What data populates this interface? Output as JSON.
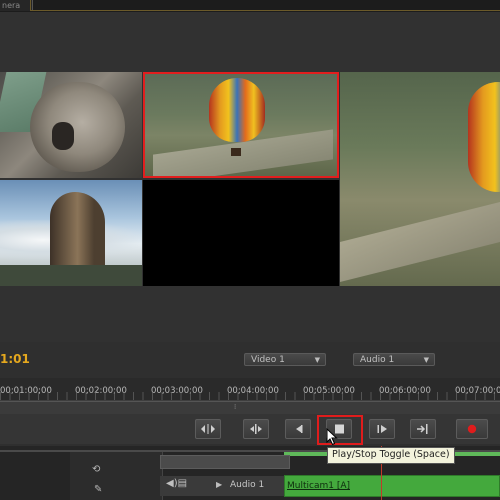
{
  "panel": {
    "tab_label": "nera"
  },
  "monitor": {
    "timecode": "1:01",
    "video_dropdown": "Video 1",
    "audio_dropdown": "Audio 1",
    "selected_camera": 2
  },
  "ruler": {
    "ticks": [
      "00;01:00;00",
      "00;02:00;00",
      "00;03:00;00",
      "00;04:00;00",
      "00;05:00;00",
      "00;06:00;00",
      "00;07:00;00"
    ]
  },
  "transport": {
    "buttons": [
      {
        "name": "trim-button",
        "icon": "trim-icon"
      },
      {
        "name": "mark-in-button",
        "icon": "mark-in-icon"
      },
      {
        "name": "step-back-button",
        "icon": "step-back-icon"
      },
      {
        "name": "play-stop-button",
        "icon": "stop-icon"
      },
      {
        "name": "step-forward-button",
        "icon": "step-forward-icon"
      },
      {
        "name": "go-to-out-button",
        "icon": "go-to-out-icon"
      },
      {
        "name": "record-button",
        "icon": "record-icon"
      }
    ],
    "tooltip": "Play/Stop Toggle (Space)",
    "record_color": "#e01c1c"
  },
  "timeline": {
    "audio_track_label": "Audio 1",
    "clip_name": "Multicam1 [A]",
    "clip_color": "#44a93d"
  }
}
